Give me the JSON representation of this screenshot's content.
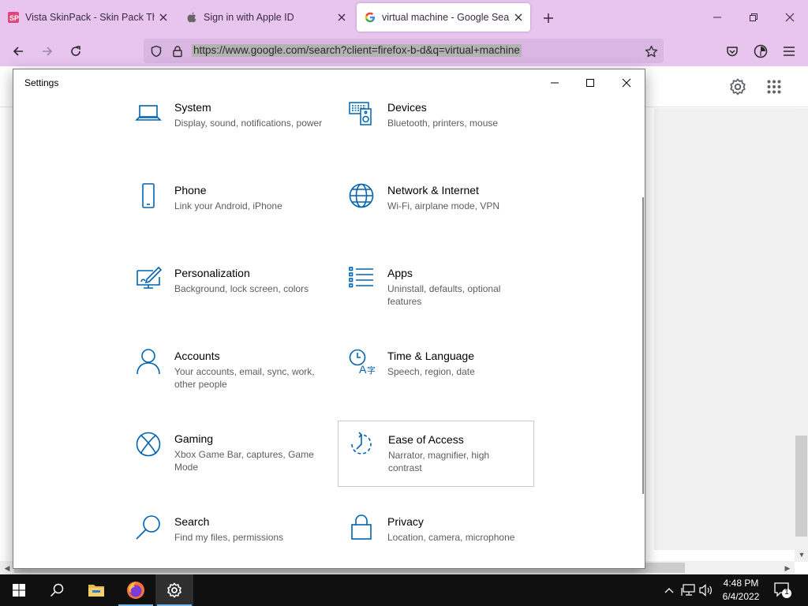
{
  "browser": {
    "tabs": [
      {
        "title": "Vista SkinPack - Skin Pack Ther",
        "favicon": "skinpack-favicon",
        "active": false
      },
      {
        "title": "Sign in with Apple ID",
        "favicon": "apple-favicon",
        "active": false
      },
      {
        "title": "virtual machine - Google Search",
        "favicon": "google-favicon",
        "active": true
      }
    ],
    "url": "https://www.google.com/search?client=firefox-b-d&q=virtual+machine",
    "accent_color": "#e7c5ef"
  },
  "settings": {
    "window_title": "Settings",
    "tiles": [
      {
        "name": "System",
        "desc": "Display, sound, notifications, power",
        "icon": "laptop-icon"
      },
      {
        "name": "Devices",
        "desc": "Bluetooth, printers, mouse",
        "icon": "devices-icon"
      },
      {
        "name": "Phone",
        "desc": "Link your Android, iPhone",
        "icon": "phone-icon"
      },
      {
        "name": "Network & Internet",
        "desc": "Wi-Fi, airplane mode, VPN",
        "icon": "globe-icon"
      },
      {
        "name": "Personalization",
        "desc": "Background, lock screen, colors",
        "icon": "paint-icon"
      },
      {
        "name": "Apps",
        "desc": "Uninstall, defaults, optional features",
        "icon": "apps-list-icon"
      },
      {
        "name": "Accounts",
        "desc": "Your accounts, email, sync, work, other people",
        "icon": "person-icon"
      },
      {
        "name": "Time & Language",
        "desc": "Speech, region, date",
        "icon": "time-language-icon"
      },
      {
        "name": "Gaming",
        "desc": "Xbox Game Bar, captures, Game Mode",
        "icon": "xbox-icon"
      },
      {
        "name": "Ease of Access",
        "desc": "Narrator, magnifier, high contrast",
        "icon": "ease-of-access-icon"
      },
      {
        "name": "Search",
        "desc": "Find my files, permissions",
        "icon": "search-icon"
      },
      {
        "name": "Privacy",
        "desc": "Location, camera, microphone",
        "icon": "lock-icon"
      }
    ],
    "icon_color": "#0063b1"
  },
  "taskbar": {
    "time": "4:48 PM",
    "date": "6/4/2022",
    "notification_count": "1"
  }
}
